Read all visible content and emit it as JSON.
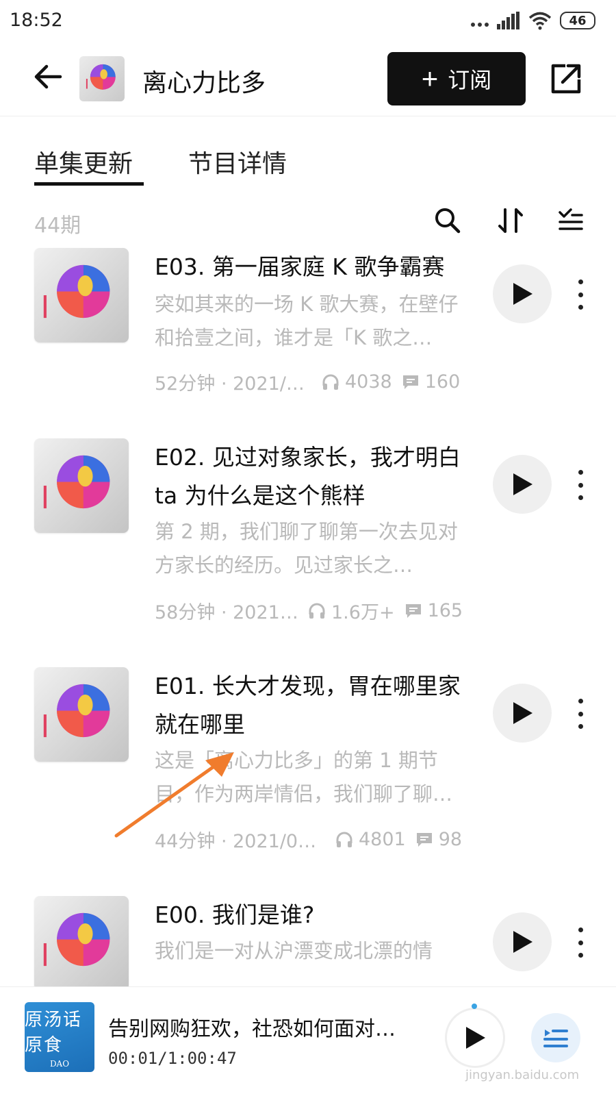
{
  "status_bar": {
    "time": "18:52",
    "battery": "46"
  },
  "header": {
    "title": "离心力比多",
    "subscribe_label": "订阅"
  },
  "tabs": [
    {
      "label": "单集更新"
    },
    {
      "label": "节目详情"
    }
  ],
  "list_header": {
    "count": "44期"
  },
  "episodes": [
    {
      "title": "E03. 第一届家庭 K 歌争霸赛",
      "description": "突如其来的一场 K 歌大赛，在壁仔和拾壹之间，谁才是「K 歌之…",
      "duration_date": "52分钟 · 2021/…",
      "plays": "4038",
      "comments": "160"
    },
    {
      "title": "E02. 见过对象家长，我才明白 ta 为什么是这个熊样",
      "description": "第 2 期，我们聊了聊第一次去见对方家长的经历。见过家长之…",
      "duration_date": "58分钟 · 2021…",
      "plays": "1.6万+",
      "comments": "165"
    },
    {
      "title": "E01. 长大才发现，胃在哪里家就在哪里",
      "description": "这是「离心力比多」的第 1 期节目，作为两岸情侣，我们聊了聊…",
      "duration_date": "44分钟 · 2021/0…",
      "plays": "4801",
      "comments": "98"
    },
    {
      "title": "E00. 我们是谁?",
      "description": "我们是一对从沪漂变成北漂的情",
      "duration_date": "",
      "plays": "",
      "comments": ""
    }
  ],
  "mini_player": {
    "title": "告别网购狂欢，社恐如何面对…",
    "time": "00:01/1:00:47",
    "cover_text_1": "原汤话原食",
    "cover_text_2": "DAO"
  },
  "watermark": "jingyan.baidu.com",
  "colors": {
    "accent": "#111111",
    "muted": "#b9b9b9",
    "annotation_arrow": "#f07c2d"
  }
}
